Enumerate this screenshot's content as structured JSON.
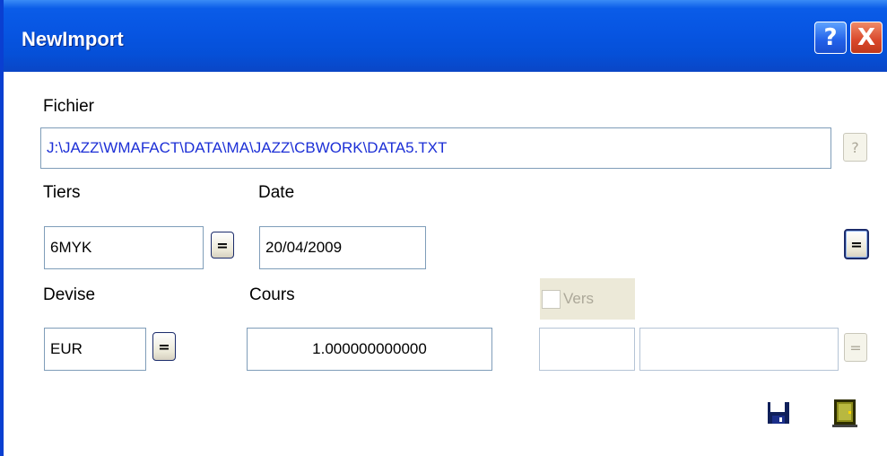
{
  "window": {
    "title": "NewImport",
    "help_button": "?",
    "close_button": "X"
  },
  "fichier": {
    "label": "Fichier",
    "value": "J:\\JAZZ\\WMAFACT\\DATA\\MA\\JAZZ\\CBWORK\\DATA5.TXT",
    "browse_button": "?"
  },
  "tiers": {
    "label": "Tiers",
    "value": "6MYK",
    "button": "="
  },
  "date": {
    "label": "Date",
    "value": "20/04/2009",
    "button": "="
  },
  "devise": {
    "label": "Devise",
    "value": "EUR",
    "button": "="
  },
  "cours": {
    "label": "Cours",
    "value": "1.000000000000"
  },
  "vers": {
    "label": "Vers",
    "checked": false,
    "code_value": "",
    "name_value": "",
    "button": "="
  },
  "toolbar": {
    "save_icon": "floppy-disk-icon",
    "exit_icon": "door-exit-icon"
  },
  "colors": {
    "titlebar": "#0755e2",
    "path_text": "#1c2fd6",
    "field_border": "#7f9db9",
    "dialog_bg": "#ffffff"
  }
}
